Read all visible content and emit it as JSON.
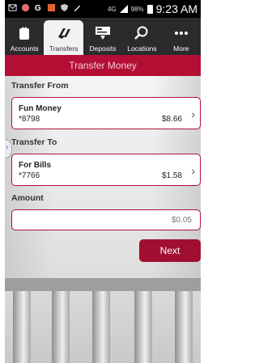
{
  "status_bar": {
    "network": "4G",
    "battery_percent": "98%",
    "time": "9:23 AM"
  },
  "tabs": [
    {
      "label": "Accounts",
      "icon": "wallet-icon",
      "active": false
    },
    {
      "label": "Transfers",
      "icon": "transfer-arrows-icon",
      "active": true
    },
    {
      "label": "Deposits",
      "icon": "check-deposit-icon",
      "active": false
    },
    {
      "label": "Locations",
      "icon": "search-icon",
      "active": false
    },
    {
      "label": "More",
      "icon": "more-dots-icon",
      "active": false
    }
  ],
  "header": {
    "title": "Transfer Money"
  },
  "transfer_from": {
    "label": "Transfer From",
    "account_name": "Fun Money",
    "account_number": "*8798",
    "balance": "$8.66"
  },
  "transfer_to": {
    "label": "Transfer To",
    "account_name": "For Bills",
    "account_number": "*7766",
    "balance": "$1.58"
  },
  "amount": {
    "label": "Amount",
    "value": "$0.05"
  },
  "next_button": {
    "label": "Next"
  },
  "colors": {
    "brand": "#b30f35",
    "tab_bar": "#2b2b2b"
  }
}
